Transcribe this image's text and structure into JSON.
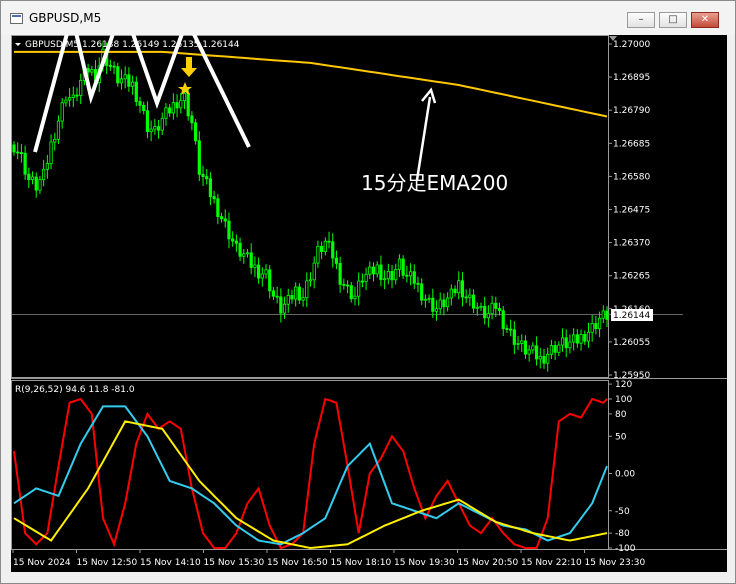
{
  "window": {
    "title": "GBPUSD,M5"
  },
  "main_chart": {
    "header": "GBPUSD,M5  1.26138 1.26149 1.26135 1.26144",
    "price_ticks": [
      "1.27000",
      "1.26895",
      "1.26790",
      "1.26685",
      "1.26580",
      "1.26475",
      "1.26370",
      "1.26265",
      "1.26160",
      "1.26055",
      "1.25950"
    ],
    "current_price": "1.26144",
    "annotation": "15分足EMA200"
  },
  "sub_chart": {
    "header": "R(9,26,52) 94.6 11.8 -81.0",
    "ticks": [
      "120",
      "100",
      "80",
      "50",
      "0.00",
      "-50",
      "-80",
      "-100"
    ]
  },
  "time_labels": [
    "15 Nov 2024",
    "15 Nov 12:50",
    "15 Nov 14:10",
    "15 Nov 15:30",
    "15 Nov 16:50",
    "15 Nov 18:10",
    "15 Nov 19:30",
    "15 Nov 20:50",
    "15 Nov 22:10",
    "15 Nov 23:30"
  ],
  "colors": {
    "candles": "#00ff00",
    "ema": "#ffc800",
    "osc_fast": "#ff0000",
    "osc_mid": "#33ccee",
    "osc_slow": "#ffee00",
    "drawing": "#ffffff",
    "arrow": "#ffd000"
  },
  "chart_data": [
    {
      "type": "candlestick",
      "title": "GBPUSD,M5",
      "ylim": [
        1.2595,
        1.27
      ],
      "x_labels": [
        "15 Nov 2024",
        "15 Nov 12:50",
        "15 Nov 14:10",
        "15 Nov 15:30",
        "15 Nov 16:50",
        "15 Nov 18:10",
        "15 Nov 19:30",
        "15 Nov 20:50",
        "15 Nov 22:10",
        "15 Nov 23:30"
      ],
      "close_path": [
        [
          0,
          1.2668
        ],
        [
          2,
          1.2664
        ],
        [
          4,
          1.2657
        ],
        [
          6,
          1.2655
        ],
        [
          8,
          1.2658
        ],
        [
          10,
          1.2668
        ],
        [
          12,
          1.2676
        ],
        [
          14,
          1.2684
        ],
        [
          16,
          1.2682
        ],
        [
          18,
          1.2688
        ],
        [
          20,
          1.2692
        ],
        [
          22,
          1.269
        ],
        [
          24,
          1.2697
        ],
        [
          26,
          1.2693
        ],
        [
          28,
          1.2689
        ],
        [
          30,
          1.2688
        ],
        [
          32,
          1.2687
        ],
        [
          34,
          1.2681
        ],
        [
          36,
          1.2674
        ],
        [
          38,
          1.2672
        ],
        [
          40,
          1.2676
        ],
        [
          42,
          1.2679
        ],
        [
          44,
          1.2682
        ],
        [
          46,
          1.2683
        ],
        [
          48,
          1.2675
        ],
        [
          50,
          1.266
        ],
        [
          52,
          1.2655
        ],
        [
          54,
          1.265
        ],
        [
          56,
          1.2645
        ],
        [
          58,
          1.264
        ],
        [
          60,
          1.2635
        ],
        [
          62,
          1.2633
        ],
        [
          64,
          1.263
        ],
        [
          66,
          1.2628
        ],
        [
          68,
          1.2627
        ],
        [
          70,
          1.262
        ],
        [
          72,
          1.2616
        ],
        [
          74,
          1.2618
        ],
        [
          76,
          1.2622
        ],
        [
          78,
          1.262
        ],
        [
          80,
          1.2627
        ],
        [
          82,
          1.2634
        ],
        [
          84,
          1.2637
        ],
        [
          86,
          1.2633
        ],
        [
          88,
          1.2626
        ],
        [
          90,
          1.2622
        ],
        [
          92,
          1.262
        ],
        [
          94,
          1.2626
        ],
        [
          96,
          1.2627
        ],
        [
          98,
          1.2629
        ],
        [
          100,
          1.2626
        ],
        [
          102,
          1.2627
        ],
        [
          104,
          1.263
        ],
        [
          106,
          1.2626
        ],
        [
          108,
          1.2625
        ],
        [
          110,
          1.2621
        ],
        [
          112,
          1.2618
        ],
        [
          114,
          1.2616
        ],
        [
          116,
          1.2618
        ],
        [
          118,
          1.262
        ],
        [
          120,
          1.2624
        ],
        [
          122,
          1.262
        ],
        [
          124,
          1.2618
        ],
        [
          126,
          1.2615
        ],
        [
          128,
          1.2614
        ],
        [
          130,
          1.2617
        ],
        [
          132,
          1.2612
        ],
        [
          134,
          1.2608
        ],
        [
          136,
          1.2605
        ],
        [
          138,
          1.2603
        ],
        [
          140,
          1.2602
        ],
        [
          142,
          1.26
        ],
        [
          144,
          1.2602
        ],
        [
          146,
          1.2604
        ],
        [
          148,
          1.2605
        ],
        [
          150,
          1.2605
        ],
        [
          152,
          1.2606
        ],
        [
          154,
          1.2608
        ],
        [
          156,
          1.261
        ],
        [
          158,
          1.2613
        ],
        [
          160,
          1.2614
        ]
      ],
      "ema_path": [
        [
          0,
          1.26975
        ],
        [
          40,
          1.26975
        ],
        [
          80,
          1.2694
        ],
        [
          120,
          1.2687
        ],
        [
          160,
          1.2677
        ]
      ],
      "last": 1.26144
    },
    {
      "type": "line",
      "title": "R(9,26,52)",
      "ylim": [
        -103,
        121
      ],
      "series": [
        {
          "values": [
            [
              0,
              30
            ],
            [
              3,
              -80
            ],
            [
              6,
              -95
            ],
            [
              9,
              -80
            ],
            [
              12,
              10
            ],
            [
              15,
              95
            ],
            [
              18,
              100
            ],
            [
              21,
              80
            ],
            [
              24,
              -60
            ],
            [
              27,
              -95
            ],
            [
              30,
              -40
            ],
            [
              33,
              40
            ],
            [
              36,
              80
            ],
            [
              39,
              60
            ],
            [
              42,
              70
            ],
            [
              45,
              60
            ],
            [
              48,
              -20
            ],
            [
              51,
              -80
            ],
            [
              54,
              -100
            ],
            [
              57,
              -100
            ],
            [
              60,
              -80
            ],
            [
              63,
              -40
            ],
            [
              66,
              -20
            ],
            [
              69,
              -70
            ],
            [
              72,
              -100
            ],
            [
              75,
              -95
            ],
            [
              78,
              -80
            ],
            [
              81,
              40
            ],
            [
              84,
              100
            ],
            [
              87,
              95
            ],
            [
              90,
              10
            ],
            [
              93,
              -80
            ],
            [
              96,
              0
            ],
            [
              99,
              20
            ],
            [
              102,
              50
            ],
            [
              105,
              30
            ],
            [
              108,
              -20
            ],
            [
              111,
              -60
            ],
            [
              114,
              -30
            ],
            [
              117,
              -10
            ],
            [
              120,
              -40
            ],
            [
              123,
              -70
            ],
            [
              126,
              -80
            ],
            [
              129,
              -60
            ],
            [
              132,
              -80
            ],
            [
              135,
              -95
            ],
            [
              138,
              -100
            ],
            [
              141,
              -100
            ],
            [
              144,
              -60
            ],
            [
              147,
              70
            ],
            [
              150,
              80
            ],
            [
              153,
              75
            ],
            [
              156,
              100
            ],
            [
              159,
              95
            ],
            [
              160,
              100
            ]
          ]
        },
        {
          "values": [
            [
              0,
              -40
            ],
            [
              6,
              -20
            ],
            [
              12,
              -30
            ],
            [
              18,
              40
            ],
            [
              24,
              90
            ],
            [
              30,
              90
            ],
            [
              36,
              50
            ],
            [
              42,
              -10
            ],
            [
              48,
              -20
            ],
            [
              54,
              -40
            ],
            [
              60,
              -70
            ],
            [
              66,
              -90
            ],
            [
              72,
              -95
            ],
            [
              78,
              -80
            ],
            [
              84,
              -60
            ],
            [
              90,
              10
            ],
            [
              96,
              40
            ],
            [
              102,
              -40
            ],
            [
              108,
              -50
            ],
            [
              114,
              -60
            ],
            [
              120,
              -40
            ],
            [
              126,
              -55
            ],
            [
              132,
              -70
            ],
            [
              138,
              -75
            ],
            [
              144,
              -90
            ],
            [
              150,
              -80
            ],
            [
              156,
              -40
            ],
            [
              160,
              10
            ]
          ]
        },
        {
          "values": [
            [
              0,
              -60
            ],
            [
              10,
              -90
            ],
            [
              20,
              -20
            ],
            [
              30,
              70
            ],
            [
              40,
              60
            ],
            [
              50,
              -10
            ],
            [
              60,
              -60
            ],
            [
              70,
              -90
            ],
            [
              80,
              -100
            ],
            [
              90,
              -95
            ],
            [
              100,
              -70
            ],
            [
              110,
              -50
            ],
            [
              120,
              -35
            ],
            [
              130,
              -65
            ],
            [
              140,
              -80
            ],
            [
              150,
              -90
            ],
            [
              160,
              -80
            ]
          ]
        }
      ]
    }
  ]
}
